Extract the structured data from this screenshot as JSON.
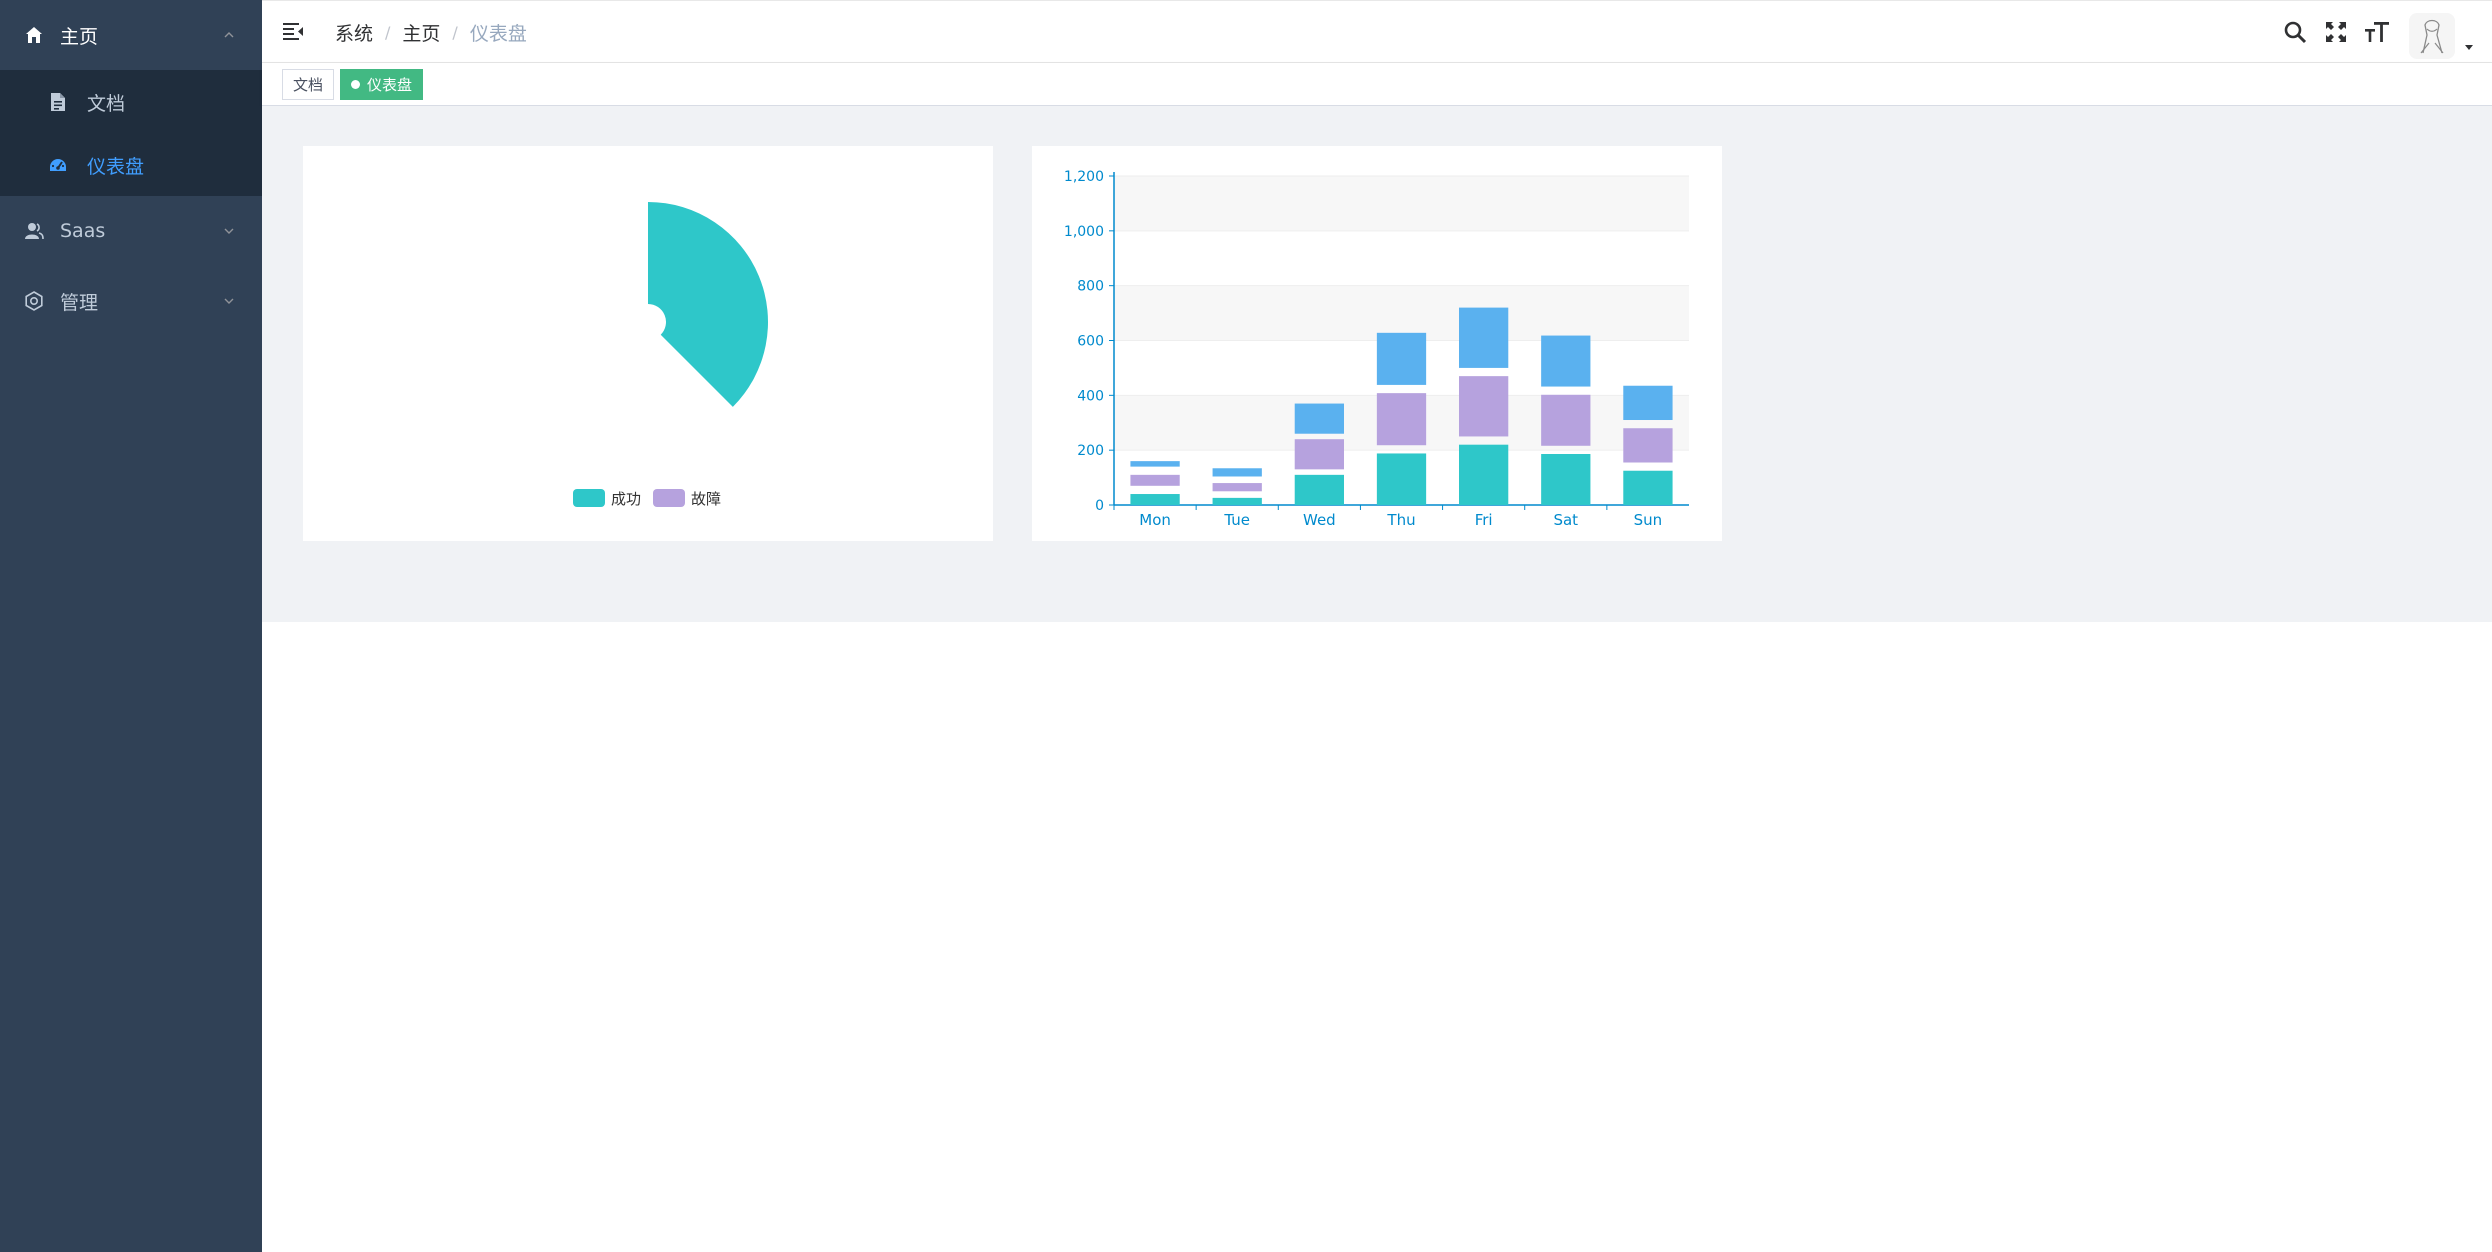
{
  "sidebar": {
    "items": [
      {
        "label": "主页",
        "icon": "home-icon",
        "expanded": true,
        "children": [
          {
            "label": "文档",
            "icon": "document-icon"
          },
          {
            "label": "仪表盘",
            "icon": "dashboard-icon",
            "active": true
          }
        ]
      },
      {
        "label": "Saas",
        "icon": "user-icon",
        "expanded": false
      },
      {
        "label": "管理",
        "icon": "gear-icon",
        "expanded": false
      }
    ]
  },
  "breadcrumb": [
    "系统",
    "主页",
    "仪表盘"
  ],
  "tags": [
    {
      "label": "文档",
      "active": false
    },
    {
      "label": "仪表盘",
      "active": true
    }
  ],
  "colors": {
    "sidebar_bg": "#304156",
    "submenu_bg": "#1f2d3d",
    "active_menu": "#409eff",
    "active_tag": "#42b983",
    "teal": "#2ec7c9",
    "purple": "#b6a2de",
    "blue": "#5ab1ef",
    "axis": "#008acd"
  },
  "chart_data": [
    {
      "type": "pie",
      "variant": "rose",
      "legend": [
        "成功",
        "故障"
      ],
      "legend_position": "bottom",
      "slices": [
        {
          "name": "成功",
          "value": 100
        },
        {
          "name": "故障",
          "value": 0
        }
      ],
      "inner_radius_ratio": 0.15
    },
    {
      "type": "bar",
      "stacked": true,
      "categories": [
        "Mon",
        "Tue",
        "Wed",
        "Thu",
        "Fri",
        "Sat",
        "Sun"
      ],
      "ylim": [
        0,
        1200
      ],
      "yticks": [
        "0",
        "200",
        "400",
        "600",
        "800",
        "1,000",
        "1,200"
      ],
      "series": [
        {
          "values": [
            40,
            26,
            110,
            188,
            220,
            186,
            125
          ]
        },
        {
          "values": [
            40,
            30,
            110,
            190,
            220,
            186,
            125
          ]
        },
        {
          "values": [
            20,
            30,
            110,
            190,
            220,
            186,
            125
          ]
        }
      ],
      "gaps": [
        30,
        24,
        20,
        30,
        30,
        30,
        30
      ]
    }
  ]
}
